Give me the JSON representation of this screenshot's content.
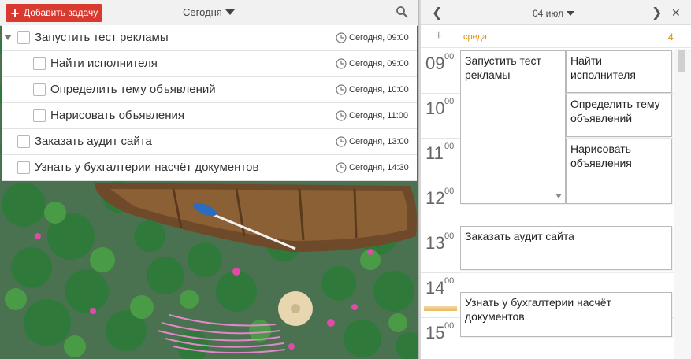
{
  "toolbar": {
    "add_task_label": "Добавить задачу",
    "period_label": "Сегодня"
  },
  "tasks": [
    {
      "title": "Запустить тест рекламы",
      "due": "Сегодня, 09:00",
      "level": 0,
      "expanded": true
    },
    {
      "title": "Найти исполнителя",
      "due": "Сегодня, 09:00",
      "level": 1
    },
    {
      "title": "Определить тему объявлений",
      "due": "Сегодня, 10:00",
      "level": 1
    },
    {
      "title": "Нарисовать объявления",
      "due": "Сегодня, 11:00",
      "level": 1
    },
    {
      "title": "Заказать аудит сайта",
      "due": "Сегодня, 13:00",
      "level": 0
    },
    {
      "title": "Узнать у бухгалтерии насчёт документов",
      "due": "Сегодня, 14:30",
      "level": 0
    }
  ],
  "calendar": {
    "date_label": "04 июл",
    "weekday": "среда",
    "day_number": "4",
    "hours": [
      {
        "h": "09",
        "m": "00"
      },
      {
        "h": "10",
        "m": "00"
      },
      {
        "h": "11",
        "m": "00"
      },
      {
        "h": "12",
        "m": "00"
      },
      {
        "h": "13",
        "m": "00"
      },
      {
        "h": "14",
        "m": "00"
      },
      {
        "h": "15",
        "m": "00"
      }
    ],
    "events": [
      {
        "title": "Запустить тест рекламы"
      },
      {
        "title": "Найти исполнителя"
      },
      {
        "title": "Определить тему объявлений"
      },
      {
        "title": "Нарисовать объявления"
      },
      {
        "title": "Заказать аудит сайта"
      },
      {
        "title": "Узнать у бухгалтерии насчёт документов"
      }
    ]
  },
  "colors": {
    "accent": "#d83a2f",
    "weekday": "#e08e0b"
  }
}
